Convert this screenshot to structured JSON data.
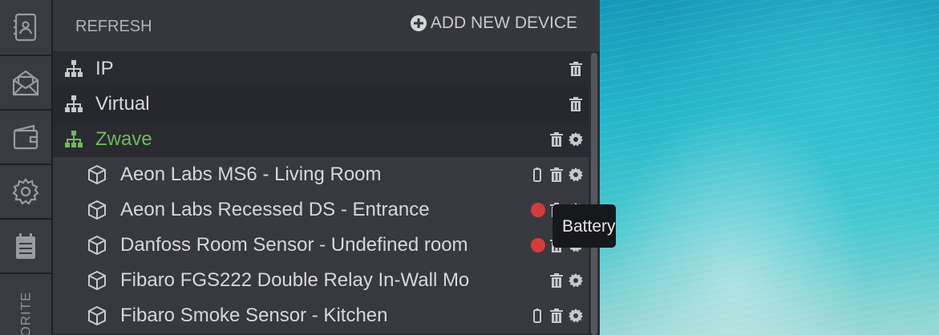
{
  "sidebar": {
    "items": [
      {
        "icon": "contacts-icon"
      },
      {
        "icon": "mail-icon"
      },
      {
        "icon": "wallet-icon"
      },
      {
        "icon": "gear-icon"
      },
      {
        "icon": "clipboard-icon"
      }
    ],
    "favorite_label": "ORITE"
  },
  "header": {
    "refresh_label": "REFRESH",
    "add_device_label": "ADD NEW DEVICE"
  },
  "tree": {
    "groups": [
      {
        "name": "IP",
        "icon": "network-icon"
      },
      {
        "name": "Virtual",
        "icon": "network-icon"
      },
      {
        "name": "Zwave",
        "icon": "network-icon",
        "active": true,
        "color": "#6fb95a"
      }
    ],
    "devices": [
      {
        "name": "Aeon Labs MS6 - Living Room",
        "icon": "cube-icon",
        "battery": true,
        "alert": false
      },
      {
        "name": "Aeon Labs Recessed DS - Entrance",
        "icon": "cube-icon",
        "battery": false,
        "alert": true
      },
      {
        "name": "Danfoss Room Sensor - Undefined room",
        "icon": "cube-icon",
        "battery": false,
        "alert": true
      },
      {
        "name": "Fibaro FGS222 Double Relay In-Wall Mo",
        "icon": "cube-icon",
        "battery": false,
        "alert": false
      },
      {
        "name": "Fibaro Smoke Sensor - Kitchen",
        "icon": "cube-icon",
        "battery": true,
        "alert": false
      }
    ]
  },
  "tooltip": {
    "text": "Battery"
  },
  "colors": {
    "alert": "#d63b3b",
    "active_group": "#6fb95a"
  }
}
